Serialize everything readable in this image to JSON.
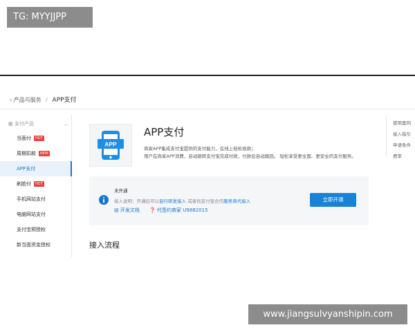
{
  "tag": "TG: MYYJJPP",
  "breadcrumb": {
    "parent": "产品与服务",
    "separator": "/",
    "current": "APP支付"
  },
  "sidebar": {
    "header": "支付产品",
    "items": [
      {
        "label": "当面付",
        "badge": "HOT"
      },
      {
        "label": "周期扣款",
        "badge": "NEW"
      },
      {
        "label": "APP支付",
        "badge": ""
      },
      {
        "label": "刷脸付",
        "badge": "HOT"
      },
      {
        "label": "手机网站支付",
        "badge": ""
      },
      {
        "label": "电脑网站支付",
        "badge": ""
      },
      {
        "label": "支付宝预授权",
        "badge": ""
      },
      {
        "label": "新当面资金授权",
        "badge": ""
      }
    ],
    "active_index": 2
  },
  "product": {
    "icon_text": "APP",
    "title": "APP支付",
    "desc_line1": "商家APP集成支付宝提供的支付能力，在线上轻松收款；",
    "desc_line2": "用户在商家APP消费，自动跳转支付宝完成付款，付款后自动跳回。 轻松享受更全面、更安全的支付服务。"
  },
  "panel": {
    "status": "未开通",
    "access_prefix": "接入说明：开通后可以",
    "access_link1": "自行研发接入",
    "access_middle": " 或者找支付宝合作",
    "access_link2": "服务商代接入",
    "docs_label": "开发文档",
    "code_label": "代签约商家 U9882015",
    "open_button": "立即开通"
  },
  "right_links": [
    "使用案例",
    "接入指引",
    "申请条件",
    "费率"
  ],
  "section_title": "接入流程",
  "watermark": "www.jiangsulvyanshipin.com",
  "colors": {
    "accent": "#1677cc",
    "button": "#1883d6",
    "hot": "#e8403c"
  }
}
